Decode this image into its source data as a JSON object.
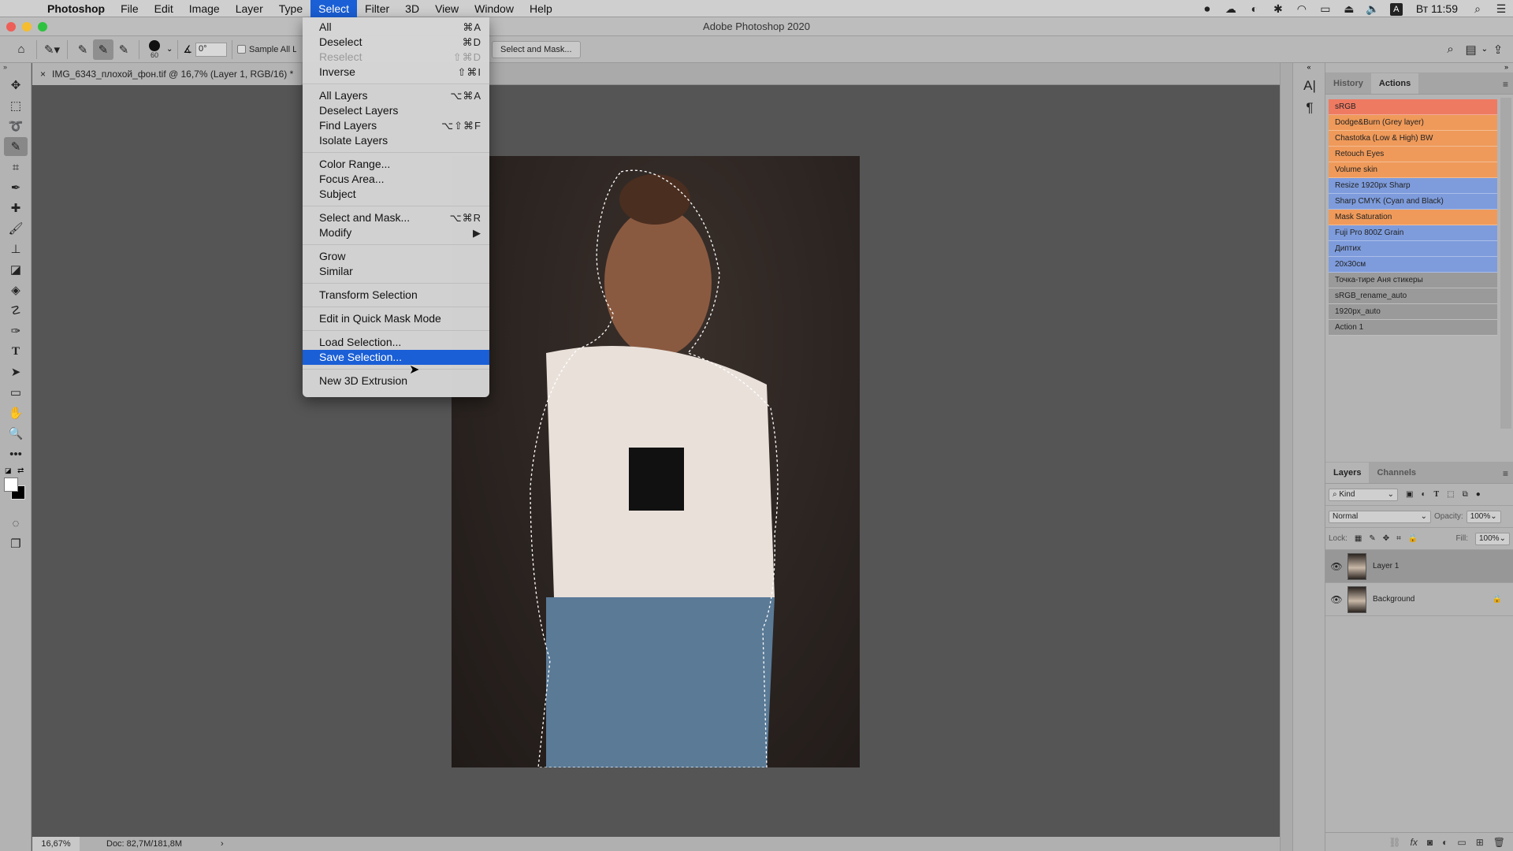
{
  "menubar": {
    "app": "Photoshop",
    "items": [
      "File",
      "Edit",
      "Image",
      "Layer",
      "Type",
      "Select",
      "Filter",
      "3D",
      "View",
      "Window",
      "Help"
    ],
    "active": "Select",
    "clock": "Вт 11:59",
    "input_lang": "A"
  },
  "window": {
    "title": "Adobe Photoshop 2020"
  },
  "options": {
    "brush_size": "60",
    "angle": "0°",
    "sample_label": "Sample All Layers",
    "select_and_mask": "Select and Mask..."
  },
  "document": {
    "tab_title": "IMG_6343_плохой_фон.tif @ 16,7% (Layer 1, RGB/16) *",
    "zoom": "16,67%",
    "doc_info": "Doc: 82,7M/181,8M"
  },
  "select_menu": {
    "groups": [
      [
        {
          "label": "All",
          "shortcut": "⌘A"
        },
        {
          "label": "Deselect",
          "shortcut": "⌘D"
        },
        {
          "label": "Reselect",
          "shortcut": "⇧⌘D",
          "disabled": true
        },
        {
          "label": "Inverse",
          "shortcut": "⇧⌘I"
        }
      ],
      [
        {
          "label": "All Layers",
          "shortcut": "⌥⌘A"
        },
        {
          "label": "Deselect Layers",
          "shortcut": ""
        },
        {
          "label": "Find Layers",
          "shortcut": "⌥⇧⌘F"
        },
        {
          "label": "Isolate Layers",
          "shortcut": ""
        }
      ],
      [
        {
          "label": "Color Range...",
          "shortcut": ""
        },
        {
          "label": "Focus Area...",
          "shortcut": ""
        },
        {
          "label": "Subject",
          "shortcut": ""
        }
      ],
      [
        {
          "label": "Select and Mask...",
          "shortcut": "⌥⌘R"
        },
        {
          "label": "Modify",
          "shortcut": "▶"
        }
      ],
      [
        {
          "label": "Grow",
          "shortcut": ""
        },
        {
          "label": "Similar",
          "shortcut": ""
        }
      ],
      [
        {
          "label": "Transform Selection",
          "shortcut": ""
        }
      ],
      [
        {
          "label": "Edit in Quick Mask Mode",
          "shortcut": ""
        }
      ],
      [
        {
          "label": "Load Selection...",
          "shortcut": ""
        },
        {
          "label": "Save Selection...",
          "shortcut": "",
          "highlighted": true
        }
      ],
      [
        {
          "label": "New 3D Extrusion",
          "shortcut": ""
        }
      ]
    ]
  },
  "actions_panel": {
    "tabs": [
      "History",
      "Actions"
    ],
    "active_tab": "Actions",
    "items": [
      {
        "label": "sRGB",
        "color": "#ef7a62"
      },
      {
        "label": "Dodge&Burn (Grey layer)",
        "color": "#ef9a5a"
      },
      {
        "label": "Chastotka (Low & High) BW",
        "color": "#ef9a5a"
      },
      {
        "label": "Retouch Eyes",
        "color": "#ef9a5a"
      },
      {
        "label": "Volume skin",
        "color": "#ef9a5a"
      },
      {
        "label": "Resize 1920px Sharp",
        "color": "#7e9cdc"
      },
      {
        "label": "Sharp CMYK (Cyan and Black)",
        "color": "#7e9cdc"
      },
      {
        "label": "Mask Saturation",
        "color": "#ef9a5a"
      },
      {
        "label": "Fuji Pro 800Z Grain",
        "color": "#7e9cdc"
      },
      {
        "label": "Диптих",
        "color": "#7e9cdc"
      },
      {
        "label": "20x30см",
        "color": "#7e9cdc"
      },
      {
        "label": "Точка-тире Аня стикеры",
        "color": "#9a9a9a"
      },
      {
        "label": "sRGB_rename_auto",
        "color": "#9a9a9a"
      },
      {
        "label": "1920px_auto",
        "color": "#9a9a9a"
      },
      {
        "label": "Action 1",
        "color": "#9a9a9a"
      }
    ]
  },
  "layers_panel": {
    "tabs": [
      "Layers",
      "Channels"
    ],
    "active_tab": "Layers",
    "filter": "Kind",
    "blend_mode": "Normal",
    "opacity_label": "Opacity:",
    "opacity": "100%",
    "lock_label": "Lock:",
    "fill_label": "Fill:",
    "fill": "100%",
    "layers": [
      {
        "name": "Layer 1",
        "selected": true,
        "locked": false
      },
      {
        "name": "Background",
        "selected": false,
        "locked": true
      }
    ]
  }
}
